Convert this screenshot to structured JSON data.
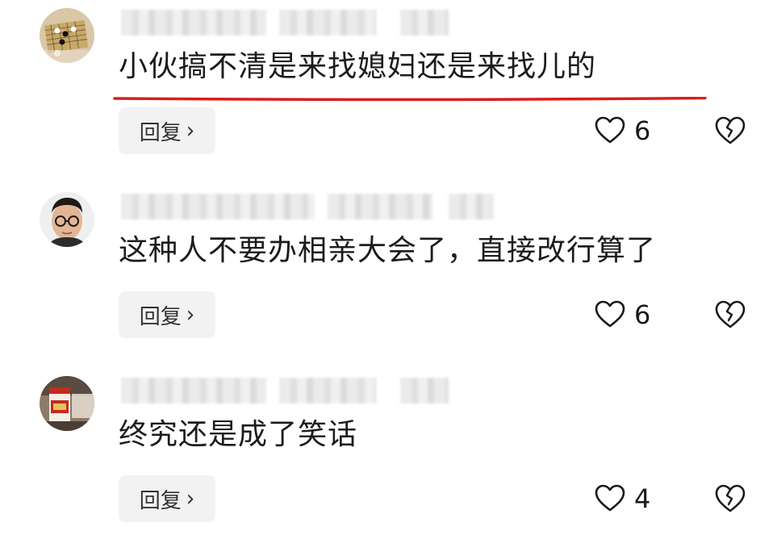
{
  "comments": [
    {
      "text": "小伙搞不清是来找媳妇还是来找儿的",
      "reply_label": "回复",
      "reply_chevron": "›",
      "likes": "6",
      "highlighted": true,
      "avatar_icon": "go-board-avatar"
    },
    {
      "text": "这种人不要办相亲大会了，直接改行算了",
      "reply_label": "回复",
      "reply_chevron": "›",
      "likes": "6",
      "highlighted": false,
      "avatar_icon": "man-with-glasses-avatar"
    },
    {
      "text": "终究还是成了笑话",
      "reply_label": "回复",
      "reply_chevron": "›",
      "likes": "4",
      "highlighted": false,
      "avatar_icon": "liquor-bottle-avatar"
    }
  ],
  "colors": {
    "highlight_underline": "#d81e1e",
    "reply_bg": "#f2f2f2",
    "text": "#1c1c1c"
  },
  "icons": {
    "like": "heart-outline-icon",
    "dislike": "broken-heart-icon",
    "reply": "chevron-right-icon"
  }
}
